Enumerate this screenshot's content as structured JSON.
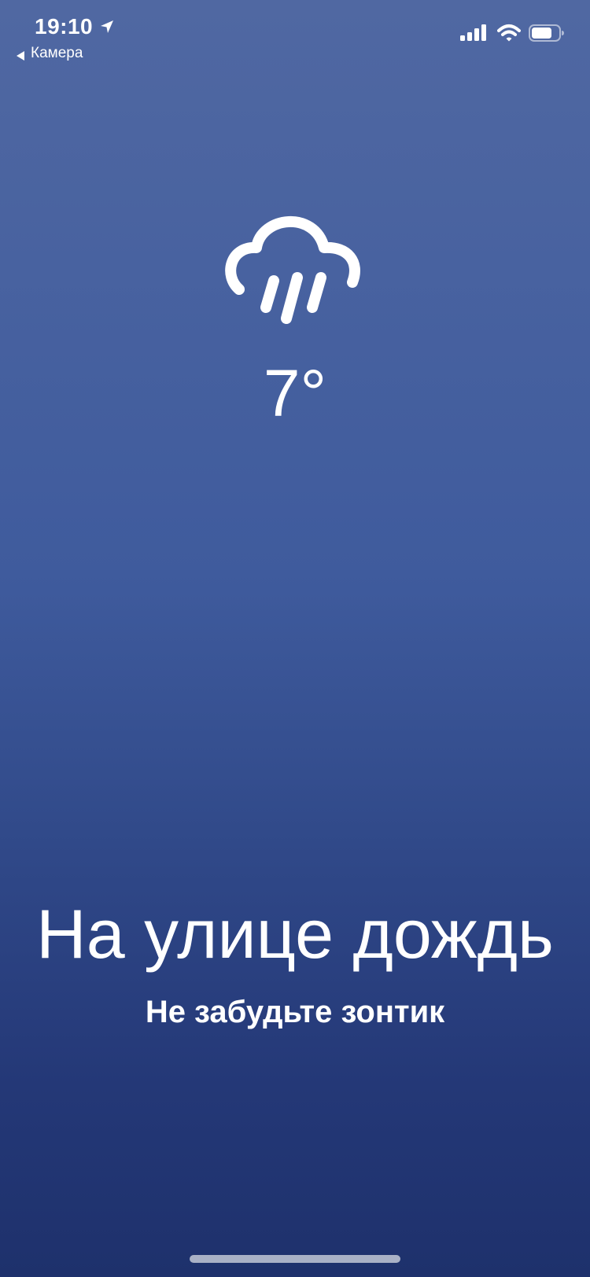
{
  "status_bar": {
    "time": "19:10",
    "back_label": "Камера",
    "icons": [
      "location-arrow-icon",
      "cellular-signal-icon",
      "wifi-icon",
      "battery-icon"
    ]
  },
  "weather": {
    "icon": "rain-cloud-icon",
    "temperature": "7°"
  },
  "message": {
    "headline": "На улице дождь",
    "subtitle": "Не забудьте зонтик"
  },
  "colors": {
    "background_top": "#5068a2",
    "background_bottom": "#1e316c",
    "foreground": "#ffffff",
    "home_indicator": "#a9b1c6"
  }
}
